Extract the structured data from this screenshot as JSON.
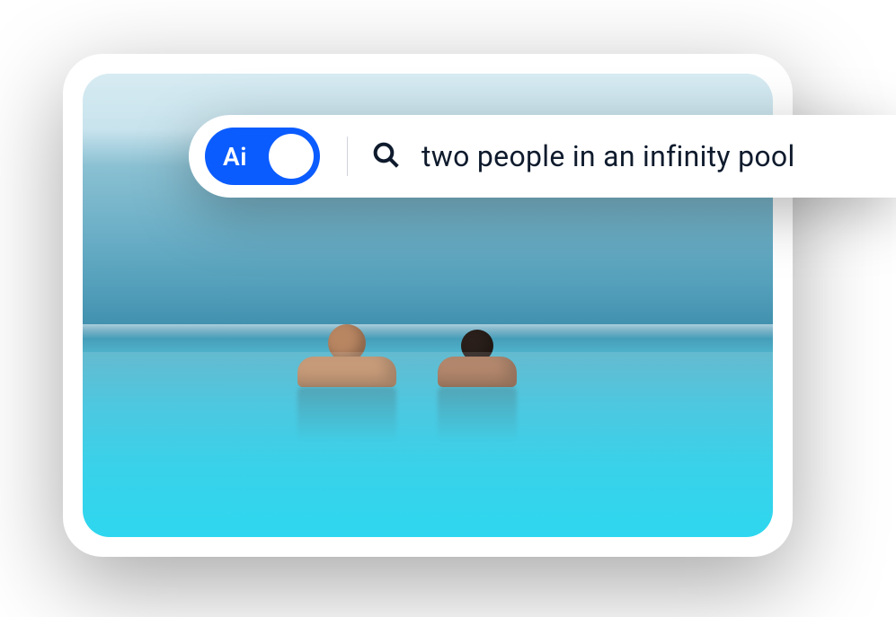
{
  "colors": {
    "accent": "#0b5cff",
    "text": "#0f1b2d"
  },
  "search": {
    "ai_toggle_label": "Ai",
    "ai_toggle_on": true,
    "query": "two people in an infinity pool",
    "placeholder": ""
  },
  "image": {
    "description": "two people resting at the edge of an infinity pool overlooking the ocean"
  }
}
